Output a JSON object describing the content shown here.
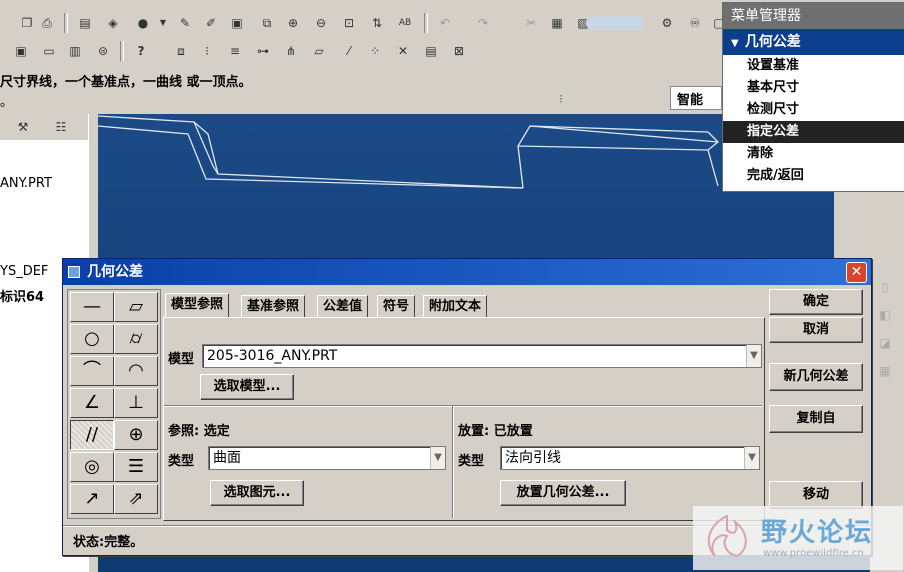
{
  "toolbar": {
    "hint_text": "尺寸界线，一个基准点，一曲线 或一顶点。",
    "left_fragment": "。",
    "filter_value": "智能"
  },
  "model_tree": {
    "items": [
      "ANY.PRT",
      "YS_DEF",
      "标识64"
    ]
  },
  "menu_manager": {
    "title": "菜单管理器",
    "submenu": "几何公差",
    "items": [
      {
        "label": "设置基准",
        "selected": false
      },
      {
        "label": "基本尺寸",
        "selected": false
      },
      {
        "label": "检测尺寸",
        "selected": false
      },
      {
        "label": "指定公差",
        "selected": true
      },
      {
        "label": "清除",
        "selected": false
      },
      {
        "label": "完成/返回",
        "selected": false
      }
    ]
  },
  "dialog": {
    "title": "几何公差",
    "tabs": [
      "模型参照",
      "基准参照",
      "公差值",
      "符号",
      "附加文本"
    ],
    "active_tab": "模型参照",
    "model_label": "模型",
    "model_value": "205-3016_ANY.PRT",
    "select_model_button": "选取模型...",
    "reference_header": "参照: 选定",
    "reference_type_label": "类型",
    "reference_type_value": "曲面",
    "select_entity_button": "选取图元...",
    "placement_header": "放置: 已放置",
    "placement_type_label": "类型",
    "placement_type_value": "法向引线",
    "place_button": "放置几何公差...",
    "buttons": {
      "ok": "确定",
      "cancel": "取消",
      "new": "新几何公差",
      "copy_from": "复制自",
      "move": "移动"
    },
    "status": "状态:完整。",
    "symbols": [
      "—",
      "▱",
      "○",
      "⌭",
      "⌒",
      "◠",
      "∠",
      "⊥",
      "//",
      "⊕",
      "◎",
      "☰",
      "↗",
      "⇗"
    ]
  },
  "watermark": {
    "text": "野火论坛",
    "url": "www.proewildfire.cn"
  },
  "colors": {
    "viewport": "#1c4a86",
    "title_bar": "#0a3ea8",
    "menu_selected": "#222222"
  }
}
